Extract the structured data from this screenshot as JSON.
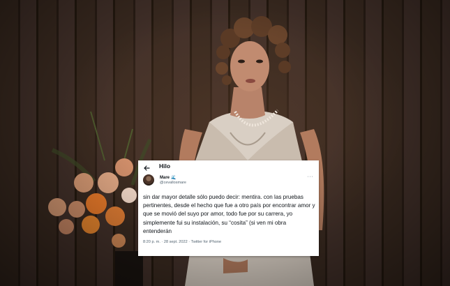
{
  "tweet": {
    "header_title": "Hilo",
    "display_name": "Mare",
    "badge_icon": "wave-emoji-icon",
    "handle": "@cevallosmare",
    "text": "sin dar mayor detalle sólo puedo decir: mentira. con las pruebas pertinentes, desde el hecho que fue a otro país por encontrar amor y que se movió del suyo por amor, todo fue por su carrera, yo simplemente fui su instalación, su “cosita” (si ven mi obra entenderán",
    "timestamp": "8:20 p. m. · 28 sept. 2022 · Twitter for iPhone",
    "more_label": "···"
  },
  "colors": {
    "text_primary": "#0f1419",
    "text_secondary": "#536471",
    "accent": "#1d9bf0"
  }
}
